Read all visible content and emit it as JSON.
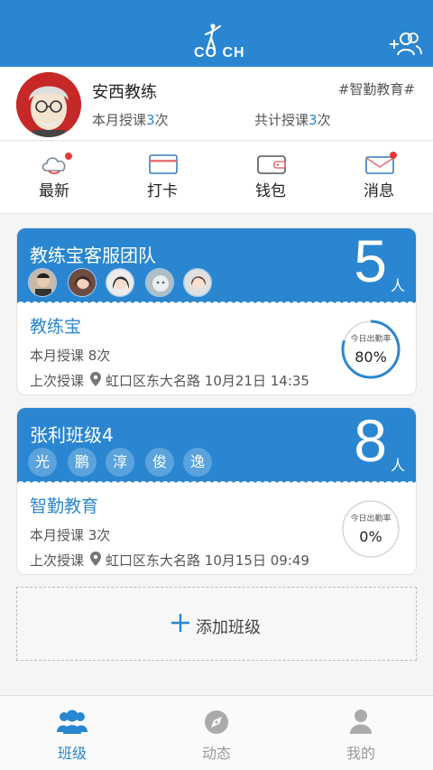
{
  "header": {
    "logo_text": "CO  CH",
    "add_user_icon": "add-user-icon"
  },
  "profile": {
    "name": "安西教练",
    "tag": "#智勤教育#",
    "month_prefix": "本月授课",
    "month_count": "3",
    "month_suffix": "次",
    "total_prefix": "共计授课",
    "total_count": "3",
    "total_suffix": "次"
  },
  "quicknav": [
    {
      "label": "最新",
      "icon": "cloud-icon",
      "has_dot": true
    },
    {
      "label": "打卡",
      "icon": "card-icon",
      "has_dot": false
    },
    {
      "label": "钱包",
      "icon": "wallet-icon",
      "has_dot": false
    },
    {
      "label": "消息",
      "icon": "mail-icon",
      "has_dot": true
    }
  ],
  "classes": [
    {
      "title": "教练宝客服团队",
      "count": "5",
      "unit": "人",
      "school": "教练宝",
      "month_text": "本月授课  8次",
      "last_label": "上次授课",
      "last_place": "虹口区东大名路 10月21日 14:35",
      "attendance_label": "今日出勤率",
      "attendance": "80%",
      "attendance_value": 0.8
    },
    {
      "title": "张利班级4",
      "count": "8",
      "unit": "人",
      "members": [
        "光",
        "鹏",
        "淳",
        "俊",
        "逸"
      ],
      "school": "智勤教育",
      "month_text": "本月授课  3次",
      "last_label": "上次授课",
      "last_place": "虹口区东大名路 10月15日 09:49",
      "attendance_label": "今日出勤率",
      "attendance": "0%",
      "attendance_value": 0
    }
  ],
  "add_class": {
    "label": "添加班级"
  },
  "tabs": [
    {
      "label": "班级",
      "active": true
    },
    {
      "label": "动态",
      "active": false
    },
    {
      "label": "我的",
      "active": false
    }
  ],
  "colors": {
    "primary": "#2a86d0",
    "badge": "#e53935"
  }
}
